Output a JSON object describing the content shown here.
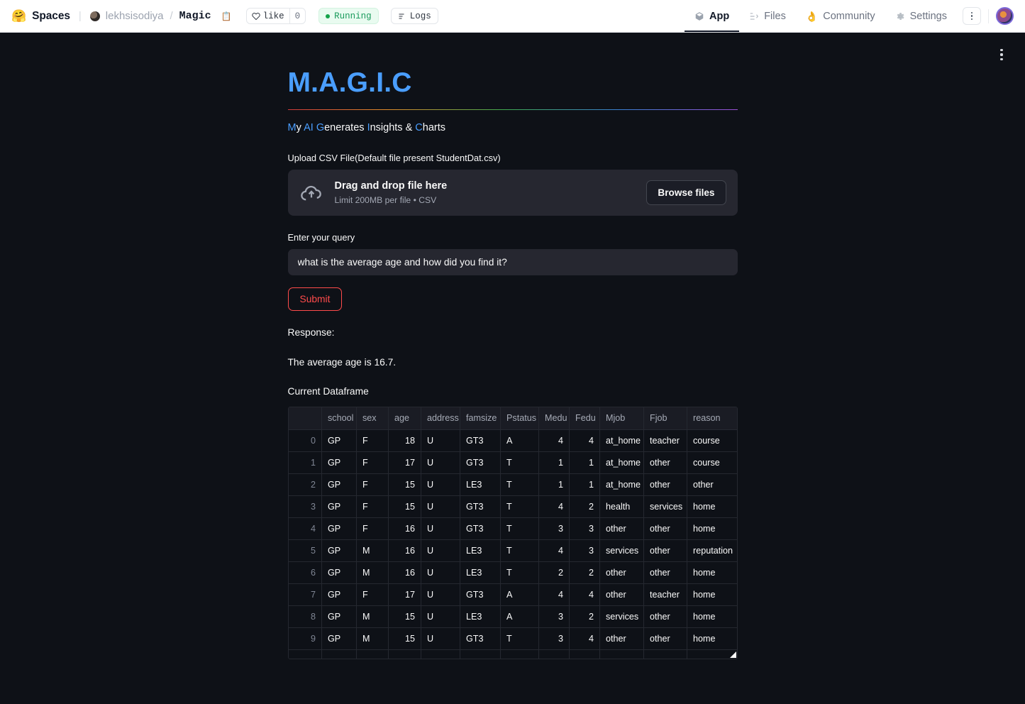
{
  "hf_header": {
    "logo_icon": "huggingface-emoji",
    "spaces_label": "Spaces",
    "owner": "lekhsisodiya",
    "slash": "/",
    "repo": "Magic",
    "copy_icon": "copy-icon",
    "like_label": "like",
    "like_count": "0",
    "status_label": "Running",
    "logs_label": "Logs",
    "tabs": [
      {
        "label": "App",
        "icon": "cube-icon",
        "active": true
      },
      {
        "label": "Files",
        "icon": "files-icon",
        "active": false
      },
      {
        "label": "Community",
        "icon": "community-hand-icon",
        "active": false
      },
      {
        "label": "Settings",
        "icon": "gear-icon",
        "active": false
      }
    ],
    "kebab_icon": "kebab-menu-icon",
    "avatar_icon": "user-avatar"
  },
  "app": {
    "menu_icon": "streamlit-main-menu-icon",
    "title": "M.A.G.I.C",
    "subtitle_parts": [
      {
        "text": "M",
        "accent": true
      },
      {
        "text": "y ",
        "accent": false
      },
      {
        "text": "AI",
        "accent": true
      },
      {
        "text": " ",
        "accent": false
      },
      {
        "text": "G",
        "accent": true
      },
      {
        "text": "enerates ",
        "accent": false
      },
      {
        "text": "I",
        "accent": true
      },
      {
        "text": "nsights & ",
        "accent": false
      },
      {
        "text": "C",
        "accent": true
      },
      {
        "text": "harts",
        "accent": false
      }
    ],
    "subtitle_plain": "My AI Generates Insights & Charts",
    "upload_label": "Upload CSV File(Default file present StudentDat.csv)",
    "uploader": {
      "icon": "cloud-upload-icon",
      "drag_text": "Drag and drop file here",
      "limit_text": "Limit 200MB per file • CSV",
      "browse_label": "Browse files"
    },
    "query_label": "Enter your query",
    "query_value": "what is the average age and how did you find it?",
    "query_placeholder": "",
    "submit_label": "Submit",
    "response_label": "Response:",
    "response_text": "The average age is 16.7.",
    "dataframe_label": "Current Dataframe",
    "accent_color": "#4a9eff",
    "submit_color": "#ff4b4b",
    "background_color": "#0e1117"
  },
  "dataframe": {
    "index_header": "",
    "columns": [
      "school",
      "sex",
      "age",
      "address",
      "famsize",
      "Pstatus",
      "Medu",
      "Fedu",
      "Mjob",
      "Fjob",
      "reason"
    ],
    "numeric_columns": [
      "age",
      "Medu",
      "Fedu"
    ],
    "rows": [
      {
        "index": "0",
        "cells": [
          "GP",
          "F",
          "18",
          "U",
          "GT3",
          "A",
          "4",
          "4",
          "at_home",
          "teacher",
          "course"
        ]
      },
      {
        "index": "1",
        "cells": [
          "GP",
          "F",
          "17",
          "U",
          "GT3",
          "T",
          "1",
          "1",
          "at_home",
          "other",
          "course"
        ]
      },
      {
        "index": "2",
        "cells": [
          "GP",
          "F",
          "15",
          "U",
          "LE3",
          "T",
          "1",
          "1",
          "at_home",
          "other",
          "other"
        ]
      },
      {
        "index": "3",
        "cells": [
          "GP",
          "F",
          "15",
          "U",
          "GT3",
          "T",
          "4",
          "2",
          "health",
          "services",
          "home"
        ]
      },
      {
        "index": "4",
        "cells": [
          "GP",
          "F",
          "16",
          "U",
          "GT3",
          "T",
          "3",
          "3",
          "other",
          "other",
          "home"
        ]
      },
      {
        "index": "5",
        "cells": [
          "GP",
          "M",
          "16",
          "U",
          "LE3",
          "T",
          "4",
          "3",
          "services",
          "other",
          "reputation"
        ]
      },
      {
        "index": "6",
        "cells": [
          "GP",
          "M",
          "16",
          "U",
          "LE3",
          "T",
          "2",
          "2",
          "other",
          "other",
          "home"
        ]
      },
      {
        "index": "7",
        "cells": [
          "GP",
          "F",
          "17",
          "U",
          "GT3",
          "A",
          "4",
          "4",
          "other",
          "teacher",
          "home"
        ]
      },
      {
        "index": "8",
        "cells": [
          "GP",
          "M",
          "15",
          "U",
          "LE3",
          "A",
          "3",
          "2",
          "services",
          "other",
          "home"
        ]
      },
      {
        "index": "9",
        "cells": [
          "GP",
          "M",
          "15",
          "U",
          "GT3",
          "T",
          "3",
          "4",
          "other",
          "other",
          "home"
        ]
      }
    ],
    "resize_handle_icon": "resize-handle-icon"
  }
}
